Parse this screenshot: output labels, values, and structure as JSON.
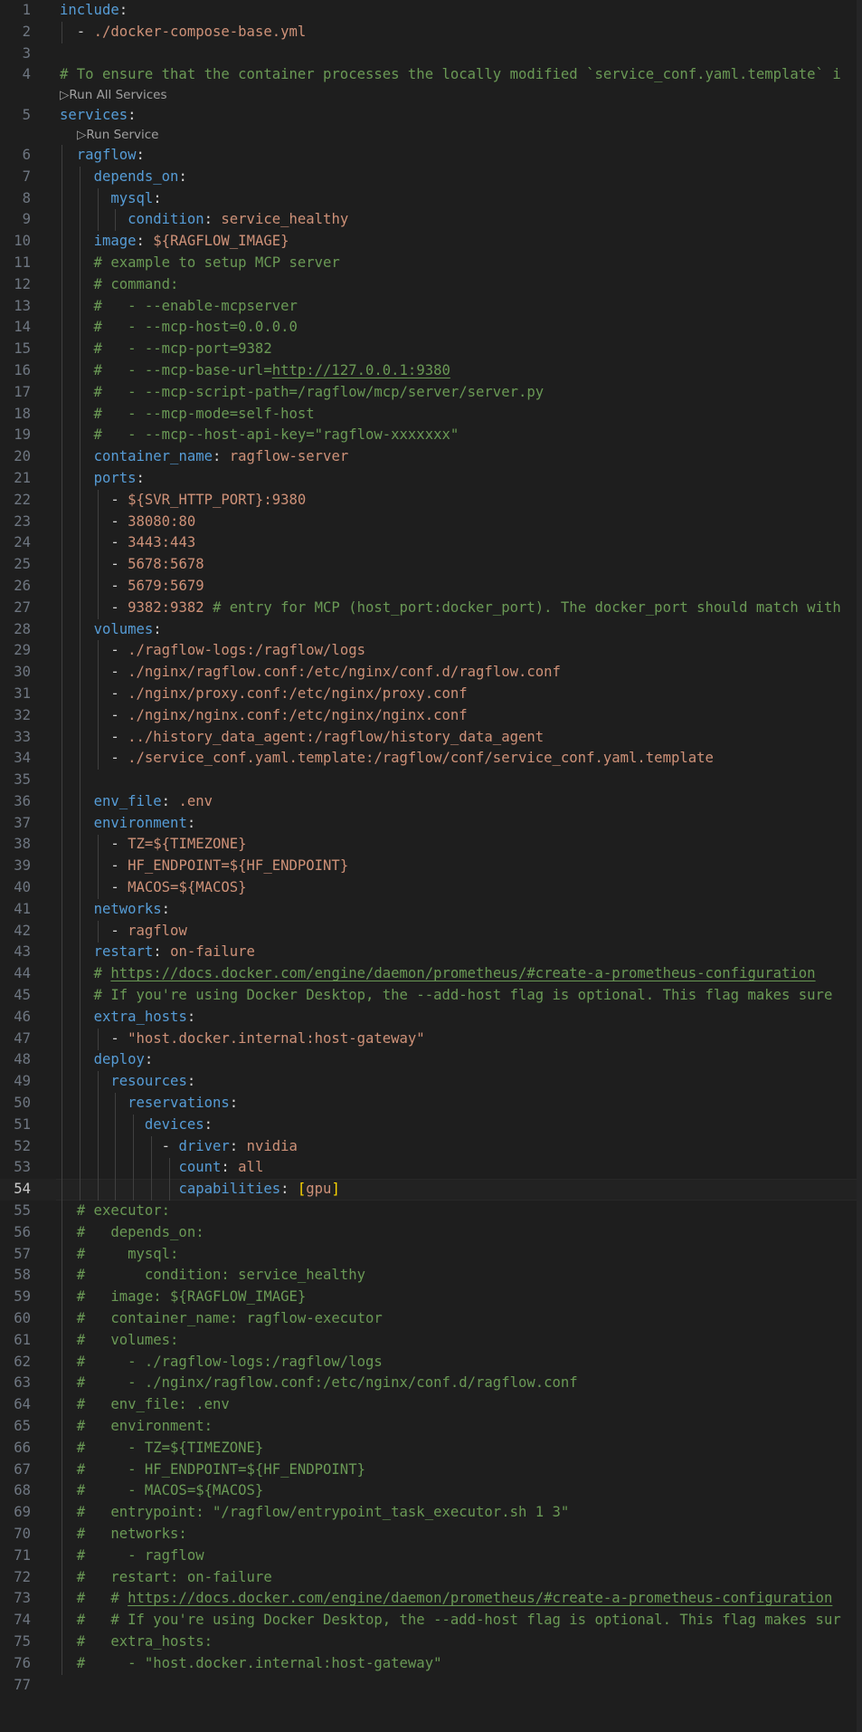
{
  "codelens": {
    "run_all": "Run All Services",
    "run_service": "Run Service"
  },
  "lines": [
    {
      "n": "1",
      "t": [
        [
          "include",
          "k"
        ],
        [
          ":",
          "p"
        ]
      ]
    },
    {
      "n": "2",
      "t": [
        [
          "  - ",
          "p"
        ],
        [
          "./docker-compose-base.yml",
          "s"
        ]
      ]
    },
    {
      "n": "3",
      "t": []
    },
    {
      "n": "4",
      "t": [
        [
          "# To ensure that the container processes the locally modified `service_conf.yaml.template` i",
          "c"
        ]
      ]
    },
    {
      "n": "5",
      "t": [
        [
          "services",
          "k"
        ],
        [
          ":",
          "p"
        ]
      ],
      "lens": "run_all"
    },
    {
      "n": "6",
      "t": [
        [
          "  ",
          "p"
        ],
        [
          "ragflow",
          "k"
        ],
        [
          ":",
          "p"
        ]
      ],
      "lens": "run_service"
    },
    {
      "n": "7",
      "t": [
        [
          "    ",
          "p"
        ],
        [
          "depends_on",
          "k"
        ],
        [
          ":",
          "p"
        ]
      ]
    },
    {
      "n": "8",
      "t": [
        [
          "      ",
          "p"
        ],
        [
          "mysql",
          "k"
        ],
        [
          ":",
          "p"
        ]
      ]
    },
    {
      "n": "9",
      "t": [
        [
          "        ",
          "p"
        ],
        [
          "condition",
          "k"
        ],
        [
          ": ",
          "p"
        ],
        [
          "service_healthy",
          "s"
        ]
      ]
    },
    {
      "n": "10",
      "t": [
        [
          "    ",
          "p"
        ],
        [
          "image",
          "k"
        ],
        [
          ": ",
          "p"
        ],
        [
          "${RAGFLOW_IMAGE}",
          "s"
        ]
      ]
    },
    {
      "n": "11",
      "t": [
        [
          "    # example to setup MCP server",
          "c"
        ]
      ]
    },
    {
      "n": "12",
      "t": [
        [
          "    # command:",
          "c"
        ]
      ]
    },
    {
      "n": "13",
      "t": [
        [
          "    #   - --enable-mcpserver",
          "c"
        ]
      ]
    },
    {
      "n": "14",
      "t": [
        [
          "    #   - --mcp-host=0.0.0.0",
          "c"
        ]
      ]
    },
    {
      "n": "15",
      "t": [
        [
          "    #   - --mcp-port=9382",
          "c"
        ]
      ]
    },
    {
      "n": "16",
      "t": [
        [
          "    #   - --mcp-base-url=",
          "c"
        ],
        [
          "http://127.0.0.1:9380",
          "u"
        ]
      ]
    },
    {
      "n": "17",
      "t": [
        [
          "    #   - --mcp-script-path=/ragflow/mcp/server/server.py",
          "c"
        ]
      ]
    },
    {
      "n": "18",
      "t": [
        [
          "    #   - --mcp-mode=self-host",
          "c"
        ]
      ]
    },
    {
      "n": "19",
      "t": [
        [
          "    #   - --mcp--host-api-key=\"ragflow-xxxxxxx\"",
          "c"
        ]
      ]
    },
    {
      "n": "20",
      "t": [
        [
          "    ",
          "p"
        ],
        [
          "container_name",
          "k"
        ],
        [
          ": ",
          "p"
        ],
        [
          "ragflow-server",
          "s"
        ]
      ]
    },
    {
      "n": "21",
      "t": [
        [
          "    ",
          "p"
        ],
        [
          "ports",
          "k"
        ],
        [
          ":",
          "p"
        ]
      ]
    },
    {
      "n": "22",
      "t": [
        [
          "      - ",
          "p"
        ],
        [
          "${SVR_HTTP_PORT}:9380",
          "s"
        ]
      ]
    },
    {
      "n": "23",
      "t": [
        [
          "      - ",
          "p"
        ],
        [
          "38080:80",
          "s"
        ]
      ]
    },
    {
      "n": "24",
      "t": [
        [
          "      - ",
          "p"
        ],
        [
          "3443:443",
          "s"
        ]
      ]
    },
    {
      "n": "25",
      "t": [
        [
          "      - ",
          "p"
        ],
        [
          "5678:5678",
          "s"
        ]
      ]
    },
    {
      "n": "26",
      "t": [
        [
          "      - ",
          "p"
        ],
        [
          "5679:5679",
          "s"
        ]
      ]
    },
    {
      "n": "27",
      "t": [
        [
          "      - ",
          "p"
        ],
        [
          "9382:9382",
          "s"
        ],
        [
          " # entry for MCP (host_port:docker_port). The docker_port should match with",
          "c"
        ]
      ]
    },
    {
      "n": "28",
      "t": [
        [
          "    ",
          "p"
        ],
        [
          "volumes",
          "k"
        ],
        [
          ":",
          "p"
        ]
      ]
    },
    {
      "n": "29",
      "t": [
        [
          "      - ",
          "p"
        ],
        [
          "./ragflow-logs:/ragflow/logs",
          "s"
        ]
      ]
    },
    {
      "n": "30",
      "t": [
        [
          "      - ",
          "p"
        ],
        [
          "./nginx/ragflow.conf:/etc/nginx/conf.d/ragflow.conf",
          "s"
        ]
      ]
    },
    {
      "n": "31",
      "t": [
        [
          "      - ",
          "p"
        ],
        [
          "./nginx/proxy.conf:/etc/nginx/proxy.conf",
          "s"
        ]
      ]
    },
    {
      "n": "32",
      "t": [
        [
          "      - ",
          "p"
        ],
        [
          "./nginx/nginx.conf:/etc/nginx/nginx.conf",
          "s"
        ]
      ]
    },
    {
      "n": "33",
      "t": [
        [
          "      - ",
          "p"
        ],
        [
          "../history_data_agent:/ragflow/history_data_agent",
          "s"
        ]
      ]
    },
    {
      "n": "34",
      "t": [
        [
          "      - ",
          "p"
        ],
        [
          "./service_conf.yaml.template:/ragflow/conf/service_conf.yaml.template",
          "s"
        ]
      ]
    },
    {
      "n": "35",
      "t": []
    },
    {
      "n": "36",
      "t": [
        [
          "    ",
          "p"
        ],
        [
          "env_file",
          "k"
        ],
        [
          ": ",
          "p"
        ],
        [
          ".env",
          "s"
        ]
      ]
    },
    {
      "n": "37",
      "t": [
        [
          "    ",
          "p"
        ],
        [
          "environment",
          "k"
        ],
        [
          ":",
          "p"
        ]
      ]
    },
    {
      "n": "38",
      "t": [
        [
          "      - ",
          "p"
        ],
        [
          "TZ=${TIMEZONE}",
          "s"
        ]
      ]
    },
    {
      "n": "39",
      "t": [
        [
          "      - ",
          "p"
        ],
        [
          "HF_ENDPOINT=${HF_ENDPOINT}",
          "s"
        ]
      ]
    },
    {
      "n": "40",
      "t": [
        [
          "      - ",
          "p"
        ],
        [
          "MACOS=${MACOS}",
          "s"
        ]
      ]
    },
    {
      "n": "41",
      "t": [
        [
          "    ",
          "p"
        ],
        [
          "networks",
          "k"
        ],
        [
          ":",
          "p"
        ]
      ]
    },
    {
      "n": "42",
      "t": [
        [
          "      - ",
          "p"
        ],
        [
          "ragflow",
          "s"
        ]
      ]
    },
    {
      "n": "43",
      "t": [
        [
          "    ",
          "p"
        ],
        [
          "restart",
          "k"
        ],
        [
          ": ",
          "p"
        ],
        [
          "on-failure",
          "s"
        ]
      ]
    },
    {
      "n": "44",
      "t": [
        [
          "    # ",
          "c"
        ],
        [
          "https://docs.docker.com/engine/daemon/prometheus/#create-a-prometheus-configuration",
          "u"
        ]
      ]
    },
    {
      "n": "45",
      "t": [
        [
          "    # If you're using Docker Desktop, the --add-host flag is optional. This flag makes sure",
          "c"
        ]
      ]
    },
    {
      "n": "46",
      "t": [
        [
          "    ",
          "p"
        ],
        [
          "extra_hosts",
          "k"
        ],
        [
          ":",
          "p"
        ]
      ]
    },
    {
      "n": "47",
      "t": [
        [
          "      - ",
          "p"
        ],
        [
          "\"host.docker.internal:host-gateway\"",
          "s"
        ]
      ]
    },
    {
      "n": "48",
      "t": [
        [
          "    ",
          "p"
        ],
        [
          "deploy",
          "k"
        ],
        [
          ":",
          "p"
        ]
      ]
    },
    {
      "n": "49",
      "t": [
        [
          "      ",
          "p"
        ],
        [
          "resources",
          "k"
        ],
        [
          ":",
          "p"
        ]
      ]
    },
    {
      "n": "50",
      "t": [
        [
          "        ",
          "p"
        ],
        [
          "reservations",
          "k"
        ],
        [
          ":",
          "p"
        ]
      ]
    },
    {
      "n": "51",
      "t": [
        [
          "          ",
          "p"
        ],
        [
          "devices",
          "k"
        ],
        [
          ":",
          "p"
        ]
      ]
    },
    {
      "n": "52",
      "t": [
        [
          "            - ",
          "p"
        ],
        [
          "driver",
          "k"
        ],
        [
          ": ",
          "p"
        ],
        [
          "nvidia",
          "s"
        ]
      ]
    },
    {
      "n": "53",
      "t": [
        [
          "              ",
          "p"
        ],
        [
          "count",
          "k"
        ],
        [
          ": ",
          "p"
        ],
        [
          "all",
          "s"
        ]
      ]
    },
    {
      "n": "54",
      "t": [
        [
          "              ",
          "p"
        ],
        [
          "capabilities",
          "k"
        ],
        [
          ": ",
          "p"
        ],
        [
          "[",
          "br"
        ],
        [
          "gpu",
          "s"
        ],
        [
          "]",
          "br"
        ]
      ],
      "current": true
    },
    {
      "n": "55",
      "t": [
        [
          "  # executor:",
          "c"
        ]
      ]
    },
    {
      "n": "56",
      "t": [
        [
          "  #   depends_on:",
          "c"
        ]
      ]
    },
    {
      "n": "57",
      "t": [
        [
          "  #     mysql:",
          "c"
        ]
      ]
    },
    {
      "n": "58",
      "t": [
        [
          "  #       condition: service_healthy",
          "c"
        ]
      ]
    },
    {
      "n": "59",
      "t": [
        [
          "  #   image: ${RAGFLOW_IMAGE}",
          "c"
        ]
      ]
    },
    {
      "n": "60",
      "t": [
        [
          "  #   container_name: ragflow-executor",
          "c"
        ]
      ]
    },
    {
      "n": "61",
      "t": [
        [
          "  #   volumes:",
          "c"
        ]
      ]
    },
    {
      "n": "62",
      "t": [
        [
          "  #     - ./ragflow-logs:/ragflow/logs",
          "c"
        ]
      ]
    },
    {
      "n": "63",
      "t": [
        [
          "  #     - ./nginx/ragflow.conf:/etc/nginx/conf.d/ragflow.conf",
          "c"
        ]
      ]
    },
    {
      "n": "64",
      "t": [
        [
          "  #   env_file: .env",
          "c"
        ]
      ]
    },
    {
      "n": "65",
      "t": [
        [
          "  #   environment:",
          "c"
        ]
      ]
    },
    {
      "n": "66",
      "t": [
        [
          "  #     - TZ=${TIMEZONE}",
          "c"
        ]
      ]
    },
    {
      "n": "67",
      "t": [
        [
          "  #     - HF_ENDPOINT=${HF_ENDPOINT}",
          "c"
        ]
      ]
    },
    {
      "n": "68",
      "t": [
        [
          "  #     - MACOS=${MACOS}",
          "c"
        ]
      ]
    },
    {
      "n": "69",
      "t": [
        [
          "  #   entrypoint: \"/ragflow/entrypoint_task_executor.sh 1 3\"",
          "c"
        ]
      ]
    },
    {
      "n": "70",
      "t": [
        [
          "  #   networks:",
          "c"
        ]
      ]
    },
    {
      "n": "71",
      "t": [
        [
          "  #     - ragflow",
          "c"
        ]
      ]
    },
    {
      "n": "72",
      "t": [
        [
          "  #   restart: on-failure",
          "c"
        ]
      ]
    },
    {
      "n": "73",
      "t": [
        [
          "  #   # ",
          "c"
        ],
        [
          "https://docs.docker.com/engine/daemon/prometheus/#create-a-prometheus-configuration",
          "u"
        ]
      ]
    },
    {
      "n": "74",
      "t": [
        [
          "  #   # If you're using Docker Desktop, the --add-host flag is optional. This flag makes sur",
          "c"
        ]
      ]
    },
    {
      "n": "75",
      "t": [
        [
          "  #   extra_hosts:",
          "c"
        ]
      ]
    },
    {
      "n": "76",
      "t": [
        [
          "  #     - \"host.docker.internal:host-gateway\"",
          "c"
        ]
      ]
    },
    {
      "n": "77",
      "t": []
    }
  ]
}
